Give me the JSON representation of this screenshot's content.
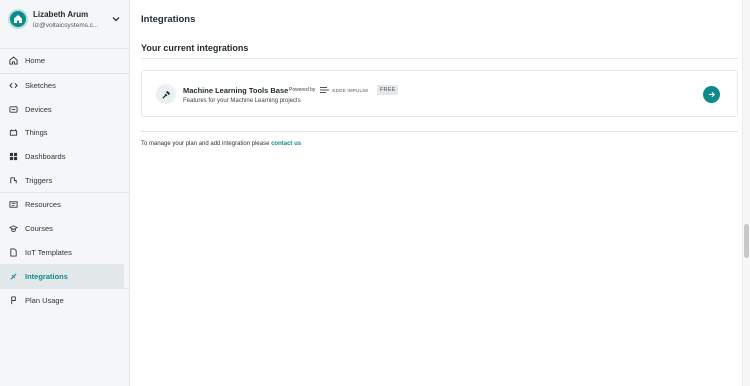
{
  "user": {
    "name": "Lizabeth Arum",
    "email": "liz@voltaicsystems.c..."
  },
  "sidebar": {
    "items": [
      {
        "label": "Home",
        "icon": "home-icon"
      },
      {
        "label": "Sketches",
        "icon": "code-icon"
      },
      {
        "label": "Devices",
        "icon": "devices-icon"
      },
      {
        "label": "Things",
        "icon": "things-icon"
      },
      {
        "label": "Dashboards",
        "icon": "dashboard-icon"
      },
      {
        "label": "Triggers",
        "icon": "triggers-icon"
      },
      {
        "label": "Resources",
        "icon": "resources-icon"
      },
      {
        "label": "Courses",
        "icon": "courses-icon"
      },
      {
        "label": "IoT Templates",
        "icon": "templates-icon"
      },
      {
        "label": "Integrations",
        "icon": "integrations-icon",
        "active": true
      },
      {
        "label": "Plan Usage",
        "icon": "plan-usage-icon"
      }
    ]
  },
  "main": {
    "title": "Integrations",
    "section_title": "Your current integrations",
    "integration": {
      "name": "Machine Learning Tools Base",
      "powered_by": "Powered by",
      "partner": "EDGE IMPULSE",
      "badge": "FREE",
      "description": "Features for your Machine Learning projects"
    },
    "manage_text": "To manage your plan and add integration please ",
    "contact_link": "contact us"
  },
  "colors": {
    "accent": "#0f8a8a",
    "sidebar_bg": "#f4f6f7"
  }
}
